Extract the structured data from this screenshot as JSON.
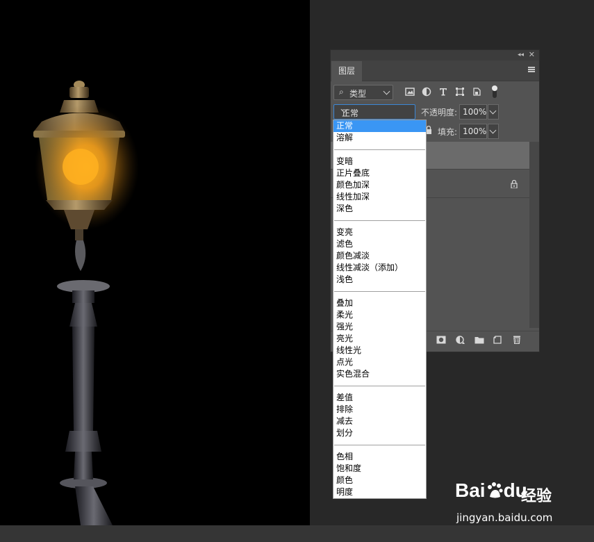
{
  "panel": {
    "tab_title": "图层",
    "collapse_glyph": "◂◂",
    "close_glyph": "✕",
    "filter": {
      "icon": "search-icon",
      "label": "类型"
    },
    "blend_mode": {
      "selected": "正常"
    },
    "opacity": {
      "label": "不透明度:",
      "value": "100%"
    },
    "fill": {
      "label": "填充:",
      "value": "100%"
    }
  },
  "blend_options": {
    "group1": [
      "正常",
      "溶解"
    ],
    "group2": [
      "变暗",
      "正片叠底",
      "颜色加深",
      "线性加深",
      "深色"
    ],
    "group3": [
      "变亮",
      "滤色",
      "颜色减淡",
      "线性减淡（添加）",
      "浅色"
    ],
    "group4": [
      "叠加",
      "柔光",
      "强光",
      "亮光",
      "线性光",
      "点光",
      "实色混合"
    ],
    "group5": [
      "差值",
      "排除",
      "减去",
      "划分"
    ],
    "group6": [
      "色相",
      "饱和度",
      "颜色",
      "明度"
    ]
  },
  "watermark": {
    "brand": "Bai",
    "brand2": "du",
    "cn": "经验",
    "url": "jingyan.baidu.com"
  },
  "colors": {
    "accent": "#3a96f4",
    "panel": "#535353",
    "canvas": "#000000"
  }
}
